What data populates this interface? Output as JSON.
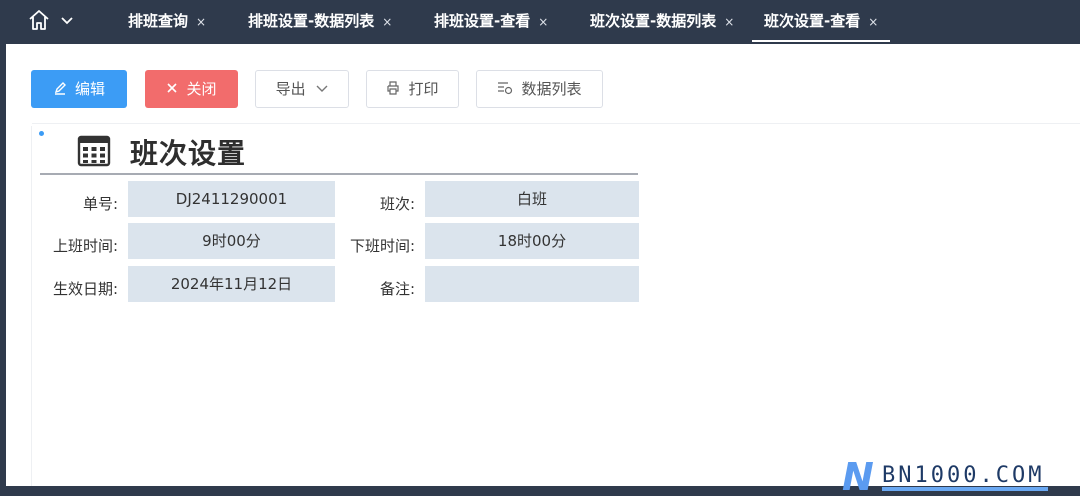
{
  "tabs": [
    {
      "label": "排班查询",
      "close": "×"
    },
    {
      "label": "排班设置-数据列表",
      "close": "×"
    },
    {
      "label": "排班设置-查看",
      "close": "×"
    },
    {
      "label": "班次设置-数据列表",
      "close": "×"
    },
    {
      "label": "班次设置-查看",
      "close": "×",
      "active": true
    }
  ],
  "toolbar": {
    "edit": "编辑",
    "close": "关闭",
    "export": "导出",
    "print": "打印",
    "data_list": "数据列表"
  },
  "form": {
    "title": "班次设置",
    "fields": {
      "number": {
        "label": "单号:",
        "value": "DJ2411290001"
      },
      "shift": {
        "label": "班次:",
        "value": "白班"
      },
      "start_time": {
        "label": "上班时间:",
        "value": "9时00分"
      },
      "end_time": {
        "label": "下班时间:",
        "value": "18时00分"
      },
      "effective_date": {
        "label": "生效日期:",
        "value": "2024年11月12日"
      },
      "remark": {
        "label": "备注:",
        "value": ""
      }
    }
  },
  "watermark": {
    "letter": "N",
    "text": "BN1000.COM"
  },
  "colors": {
    "header_bg": "#2f3a4c",
    "primary": "#3c9cf5",
    "danger": "#f26c6c",
    "field_bg": "#dbe4ed"
  },
  "icons": [
    "home-icon",
    "chevron-down-icon",
    "edit-icon",
    "close-icon",
    "printer-icon",
    "list-icon",
    "calendar-icon"
  ]
}
